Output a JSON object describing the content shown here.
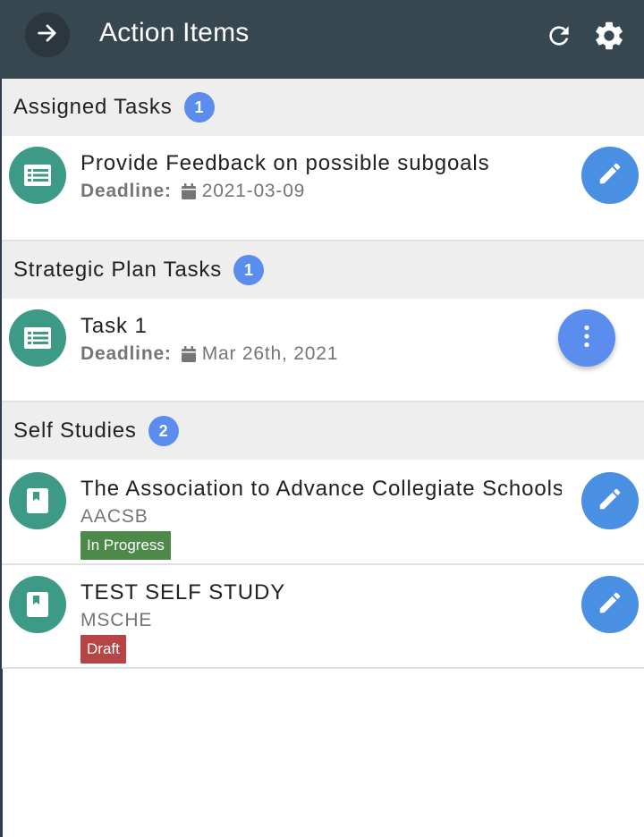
{
  "header": {
    "title": "Action Items",
    "back_icon": "arrow-right-icon",
    "refresh_icon": "refresh-icon",
    "settings_icon": "gear-icon"
  },
  "colors": {
    "header_bg": "#37474f",
    "section_bg": "#eeeeee",
    "badge": "#5b8def",
    "avatar": "#3d9a87",
    "fab": "#4a90e2",
    "in_progress": "#4d8a4a",
    "draft": "#b84545"
  },
  "sections": [
    {
      "title": "Assigned Tasks",
      "count": "1",
      "items": [
        {
          "title": "Provide Feedback on possible subgoals",
          "deadline_label": "Deadline:",
          "deadline": "2021-03-09",
          "icon": "list-icon",
          "action_icon": "pencil-icon"
        }
      ]
    },
    {
      "title": "Strategic Plan Tasks",
      "count": "1",
      "items": [
        {
          "title": "Task 1",
          "deadline_label": "Deadline:",
          "deadline": "Mar 26th, 2021",
          "icon": "list-icon",
          "action_icon": "more-vertical-icon"
        }
      ]
    },
    {
      "title": "Self Studies",
      "count": "2",
      "items": [
        {
          "title": "The Association to Advance Collegiate Schools of Business",
          "subtitle": "AACSB",
          "status": "In Progress",
          "icon": "book-icon",
          "action_icon": "pencil-icon"
        },
        {
          "title": "TEST SELF STUDY",
          "subtitle": "MSCHE",
          "status": "Draft",
          "icon": "book-icon",
          "action_icon": "pencil-icon"
        }
      ]
    }
  ]
}
